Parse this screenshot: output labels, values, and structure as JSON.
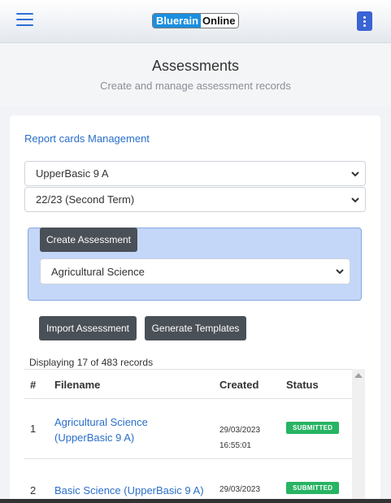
{
  "topbar": {
    "logo_part1": "Bluerain",
    "logo_part2": "Online",
    "menu_icon": "hamburger-menu-icon",
    "options_icon": "kebab-menu-icon"
  },
  "page": {
    "title": "Assessments",
    "subtitle": "Create and manage assessment records"
  },
  "breadcrumb": "Report cards Management",
  "selects": {
    "class_value": "UpperBasic 9 A",
    "term_value": "22/23 (Second Term)",
    "subject_value": "Agricultural Science"
  },
  "buttons": {
    "create": "Create Assessment",
    "import": "Import Assessment",
    "generate": "Generate Templates"
  },
  "record_count": "Displaying 17 of 483 records",
  "table": {
    "headers": [
      "#",
      "Filename",
      "Created",
      "Status"
    ],
    "rows": [
      {
        "num": "1",
        "filename": "Agricultural Science (UpperBasic 9 A)",
        "date": "29/03/2023",
        "time": "16:55:01",
        "status": "SUBMITTED"
      },
      {
        "num": "2",
        "filename": "Basic Science (UpperBasic 9 A)",
        "date": "29/03/2023",
        "time": "",
        "status": "SUBMITTED"
      }
    ]
  },
  "colors": {
    "accent": "#2a6fc9",
    "dark_button": "#4a5057",
    "submitted_badge": "#27b463",
    "assessment_panel": "#c4d7f9"
  }
}
